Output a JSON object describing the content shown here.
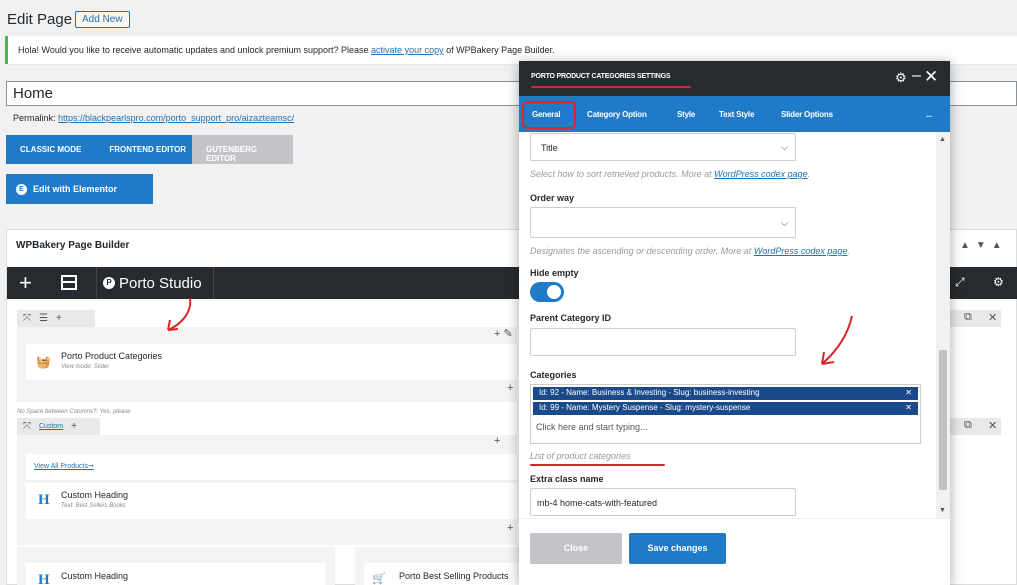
{
  "page": {
    "title": "Edit Page",
    "add_new": "Add New",
    "notice_text": "Hola! Would you like to receive automatic updates and unlock premium support? Please",
    "notice_link": "activate your copy",
    "notice_suffix": "of WPBakery Page Builder.",
    "title_value": "Home",
    "permalink_label": "Permalink:",
    "permalink_url": "https://blackpearlspro.com/porto_support_pro/aizazteamsc/",
    "classic_mode": "CLASSIC MODE",
    "frontend_editor": "FRONTEND EDITOR",
    "gutenberg_editor": "GUTENBERG EDITOR",
    "edit_elementor": "Edit with Elementor"
  },
  "builder": {
    "title": "WPBakery Page Builder",
    "studio": "Porto Studio",
    "element1_name": "Porto Product Categories",
    "element1_sub": "View mode: Slider",
    "nospace": "No Space between Columns?: Yes, please",
    "custom_tag": "Custom",
    "view_all": "View All Products➞",
    "heading1_name": "Custom Heading",
    "heading1_sub": "Text: Best Sellers Books",
    "heading2_name": "Custom Heading",
    "best_selling": "Porto Best Selling Products"
  },
  "modal": {
    "title": "PORTO PRODUCT CATEGORIES SETTINGS",
    "tabs": [
      "General",
      "Category Option",
      "Style",
      "Text Style",
      "Slider Options",
      "..."
    ],
    "orderby_value": "Title",
    "orderby_help": "Select how to sort retrieved products. More at",
    "codex_link": "WordPress codex page",
    "order_way_label": "Order way",
    "order_way_help": "Designates the ascending or descending order. More at",
    "hide_empty_label": "Hide empty",
    "parent_label": "Parent Category ID",
    "categories_label": "Categories",
    "chip1": "Id: 92 - Name: Business & Investing - Slug: business-investing",
    "chip2": "Id: 99 - Name: Mystery Suspense - Slug: mystery-suspense",
    "cat_placeholder": "Click here and start typing...",
    "cat_help": "List of product categories",
    "extra_label": "Extra class name",
    "extra_value": "mb-4 home-cats-with-featured",
    "close": "Close",
    "save": "Save changes"
  },
  "colors": {
    "accent": "#1f7bc8",
    "dark": "#272b30",
    "annotation": "#d62828"
  }
}
